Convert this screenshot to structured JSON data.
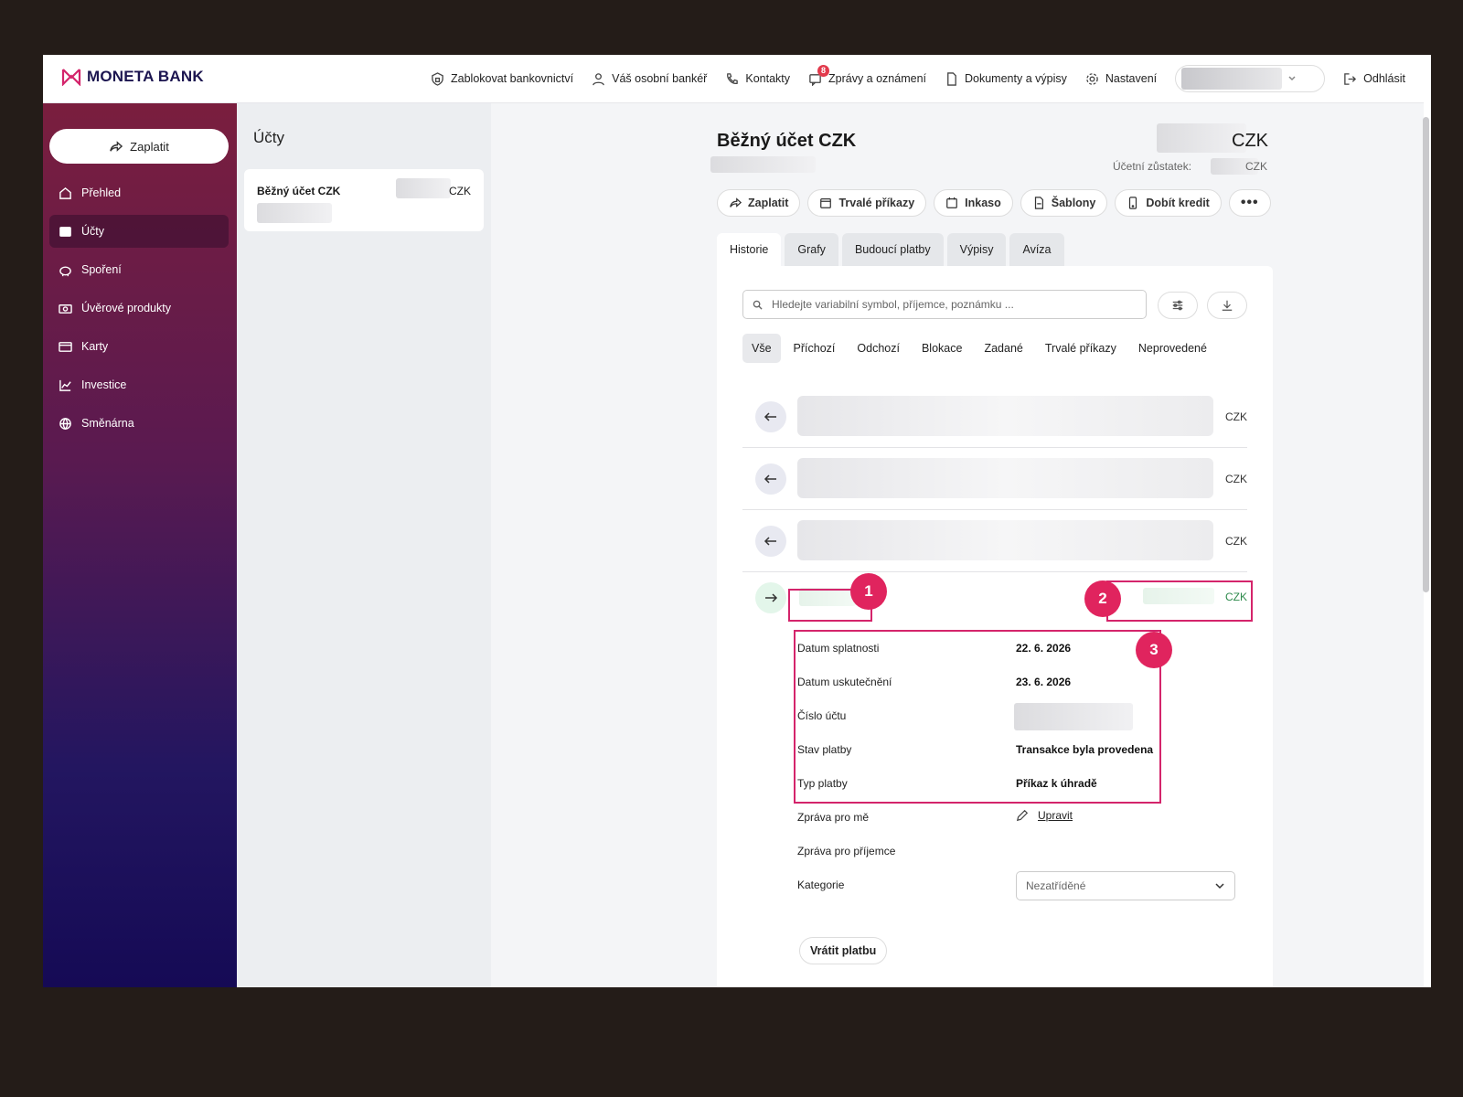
{
  "brand": {
    "name": "MONETA BANK",
    "accent": "#d4246b",
    "sidebar_top": "#7a1e3e",
    "sidebar_bottom": "#150a55"
  },
  "topnav": {
    "items": [
      {
        "label": "Zablokovat bankovnictví",
        "icon": "shield-lock-icon"
      },
      {
        "label": "Váš osobní bankéř",
        "icon": "person-icon"
      },
      {
        "label": "Kontakty",
        "icon": "phone-icon"
      },
      {
        "label": "Zprávy a oznámení",
        "icon": "message-icon",
        "badge": "8"
      },
      {
        "label": "Dokumenty a výpisy",
        "icon": "document-icon"
      },
      {
        "label": "Nastavení",
        "icon": "gear-icon"
      }
    ],
    "logout": "Odhlásit"
  },
  "sidebar": {
    "pay": "Zaplatit",
    "items": [
      {
        "label": "Přehled",
        "icon": "home-icon"
      },
      {
        "label": "Účty",
        "icon": "wallet-icon",
        "active": true
      },
      {
        "label": "Spoření",
        "icon": "piggy-bank-icon"
      },
      {
        "label": "Úvěrové produkty",
        "icon": "money-icon"
      },
      {
        "label": "Karty",
        "icon": "card-icon"
      },
      {
        "label": "Investice",
        "icon": "chart-icon"
      },
      {
        "label": "Směnárna",
        "icon": "globe-icon"
      }
    ]
  },
  "accounts": {
    "title": "Účty",
    "card": {
      "name": "Běžný účet CZK",
      "currency": "CZK"
    }
  },
  "main": {
    "title": "Běžný účet CZK",
    "currency": "CZK",
    "balance_label": "Účetní zůstatek:",
    "balance_currency": "CZK",
    "actions": [
      "Zaplatit",
      "Trvalé příkazy",
      "Inkaso",
      "Šablony",
      "Dobít kredit"
    ],
    "more": "•••",
    "tabs": [
      "Historie",
      "Grafy",
      "Budoucí platby",
      "Výpisy",
      "Avíza"
    ],
    "search_placeholder": "Hledejte variabilní symbol, příjemce, poznámku ...",
    "filters": [
      "Vše",
      "Příchozí",
      "Odchozí",
      "Blokace",
      "Zadané",
      "Trvalé příkazy",
      "Neprovedené"
    ],
    "transactions": [
      {
        "direction": "out",
        "currency": "CZK"
      },
      {
        "direction": "out",
        "currency": "CZK"
      },
      {
        "direction": "out",
        "currency": "CZK"
      },
      {
        "direction": "in",
        "currency": "CZK"
      }
    ],
    "annotations": [
      "1",
      "2",
      "3"
    ],
    "details": [
      {
        "label": "Datum splatnosti",
        "value": "22. 6. 2026"
      },
      {
        "label": "Datum uskutečnění",
        "value": "23. 6. 2026"
      },
      {
        "label": "Číslo účtu",
        "value": ""
      },
      {
        "label": "Stav platby",
        "value": "Transakce byla provedena"
      },
      {
        "label": "Typ platby",
        "value": "Příkaz k úhradě"
      },
      {
        "label": "Zpráva pro mě",
        "value": ""
      },
      {
        "label": "Zpráva pro příjemce",
        "value": ""
      },
      {
        "label": "Kategorie",
        "value": ""
      }
    ],
    "edit_label": "Upravit",
    "category_value": "Nezatříděné",
    "refund": "Vrátit platbu"
  }
}
